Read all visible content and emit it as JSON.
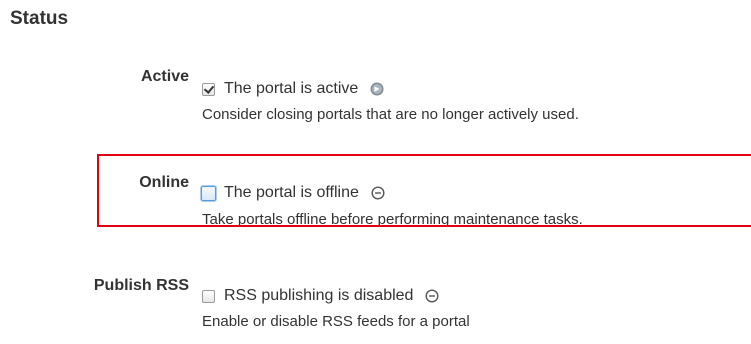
{
  "section": {
    "title": "Status"
  },
  "settings": [
    {
      "label": "Active",
      "checkbox_text": "The portal is active",
      "checked": true,
      "state_icon": "active-state-icon",
      "help": "Consider closing portals that are no longer actively used."
    },
    {
      "label": "Online",
      "checkbox_text": "The portal is offline",
      "checked": false,
      "state_icon": "disabled-state-icon",
      "help": "Take portals offline before performing maintenance tasks."
    },
    {
      "label": "Publish RSS",
      "checkbox_text": "RSS publishing is disabled",
      "checked": false,
      "state_icon": "disabled-state-icon",
      "help": "Enable or disable RSS feeds for a portal"
    }
  ],
  "colors": {
    "highlight": "#e3000f",
    "text": "#333333"
  }
}
